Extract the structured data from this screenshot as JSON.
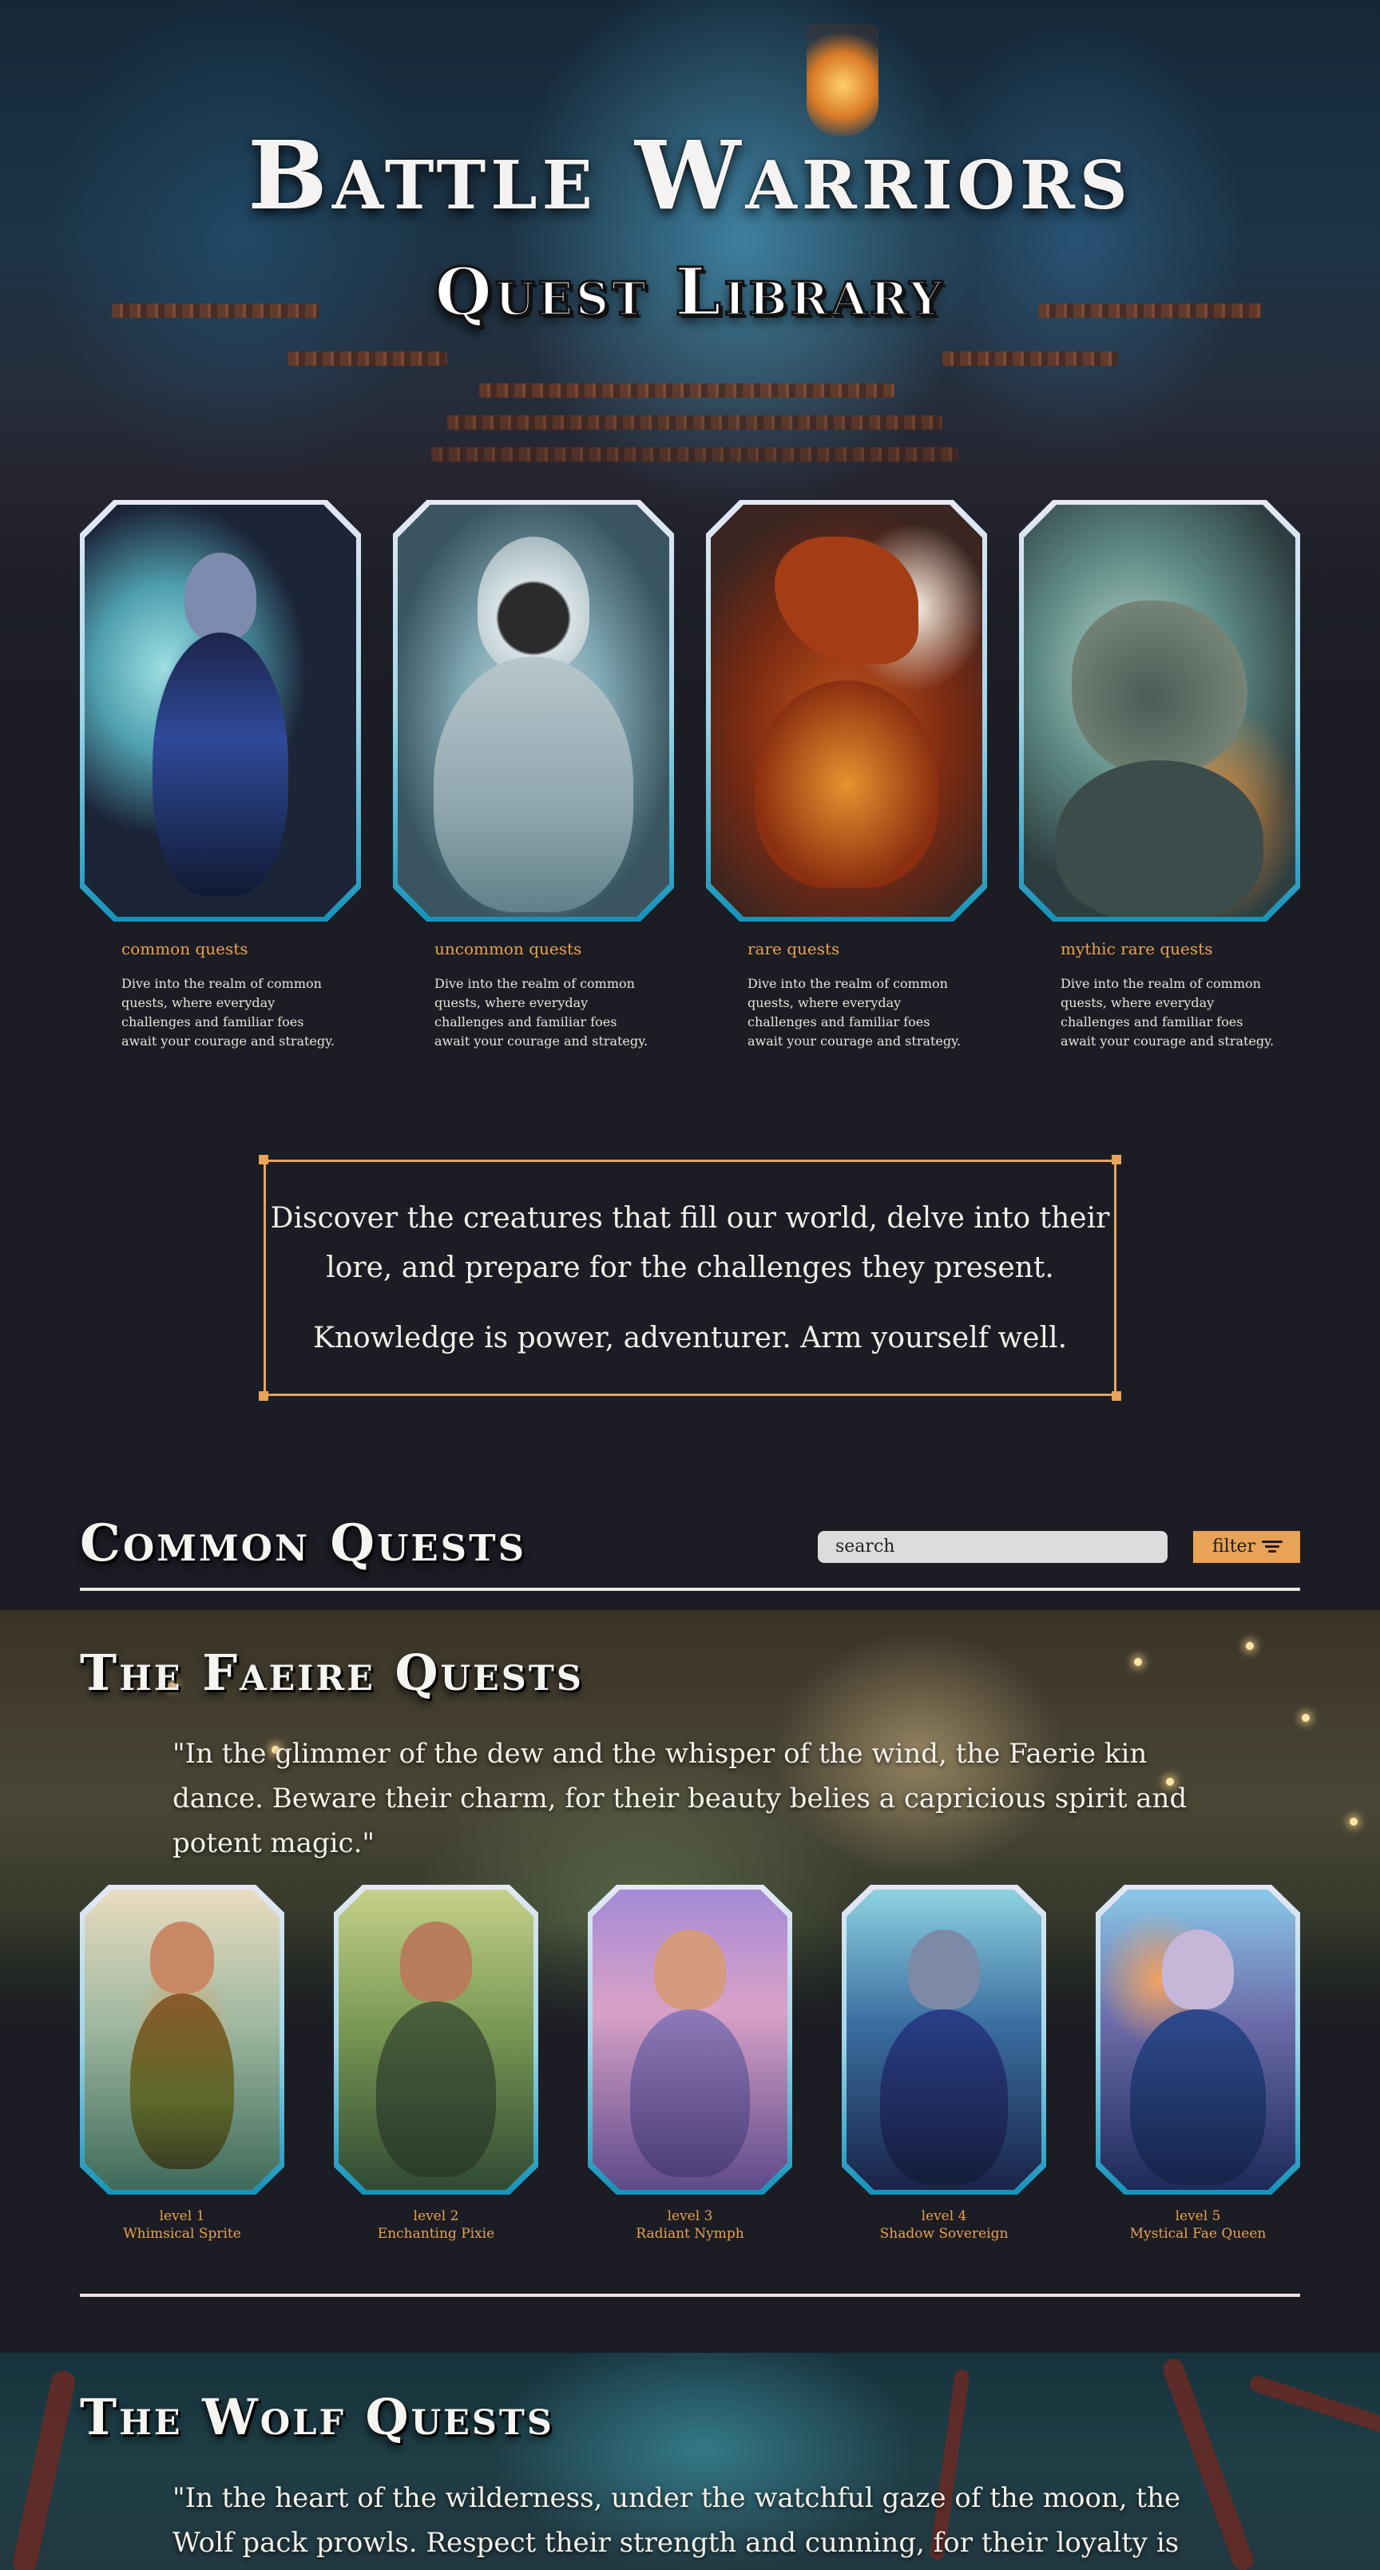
{
  "hero": {
    "title": "Battle Warriors",
    "subtitle": "Quest Library"
  },
  "quest_categories": [
    {
      "label": "common quests",
      "description": "Dive into the realm of common quests, where everyday challenges and familiar foes await your courage and strategy.",
      "art": "dark-fairy-portrait"
    },
    {
      "label": "uncommon quests",
      "description": "Dive into the realm of common quests, where everyday challenges and familiar foes await your courage and strategy.",
      "art": "hooded-wraith-portrait"
    },
    {
      "label": "rare quests",
      "description": "Dive into the realm of common quests, where everyday challenges and familiar foes await your courage and strategy.",
      "art": "fire-dragon-portrait"
    },
    {
      "label": "mythic rare quests",
      "description": "Dive into the realm of common quests, where everyday challenges and familiar foes await your courage and strategy.",
      "art": "snarling-wolf-portrait"
    }
  ],
  "intro": {
    "line1": "Discover the creatures that fill our world, delve into their lore, and prepare for the challenges they present.",
    "line2": "Knowledge is power, adventurer. Arm yourself well."
  },
  "common_section": {
    "title": "Common Quests",
    "search_placeholder": "search",
    "filter_label": "filter",
    "filter_icon": "filter-lines-icon"
  },
  "faerie_section": {
    "title": "The Faeire Quests",
    "quote": "\"In the glimmer of the dew and the whisper of the wind, the Faerie kin dance. Beware their charm, for their beauty belies a capricious spirit and potent magic.\"",
    "monsters": [
      {
        "level": "level 1",
        "name": "Whimsical Sprite",
        "art": "sprite-portrait"
      },
      {
        "level": "level 2",
        "name": "Enchanting Pixie",
        "art": "pixie-portrait"
      },
      {
        "level": "level 3",
        "name": "Radiant Nymph",
        "art": "nymph-portrait"
      },
      {
        "level": "level 4",
        "name": "Shadow Sovereign",
        "art": "shadow-sovereign-portrait"
      },
      {
        "level": "level 5",
        "name": "Mystical Fae Queen",
        "art": "fae-queen-portrait"
      }
    ]
  },
  "wolf_section": {
    "title": "The Wolf Quests",
    "quote": "\"In the heart of the wilderness, under the watchful gaze of the moon, the Wolf pack prowls. Respect their strength and cunning, for their loyalty is fierce and"
  },
  "colors": {
    "background": "#1b1c24",
    "accent": "#e9a24c",
    "card_border": "#1aa0c4",
    "text": "#e9e4da"
  }
}
